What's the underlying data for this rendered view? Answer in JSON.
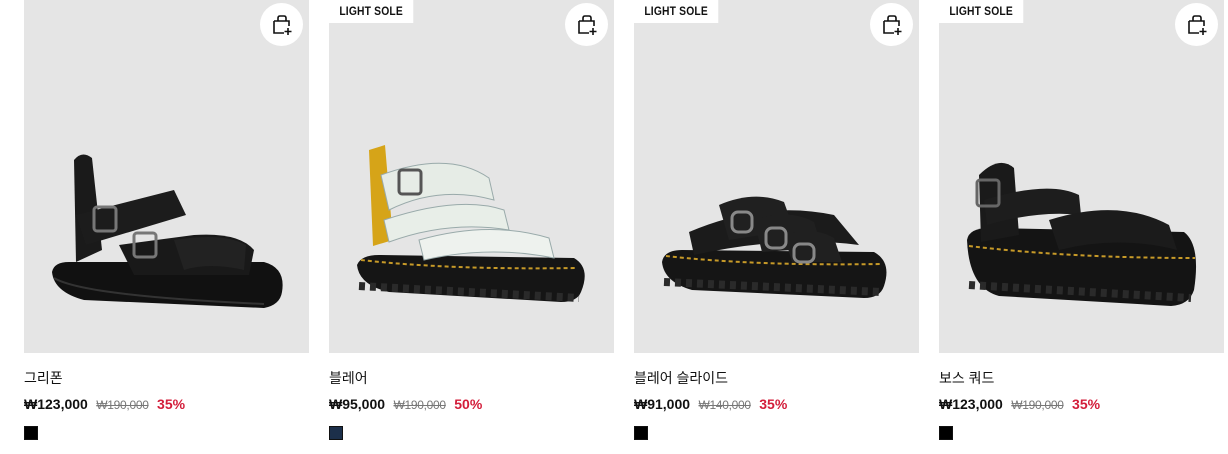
{
  "products": [
    {
      "name": "그리폰",
      "badge": "",
      "sale_price": "₩123,000",
      "original_price": "₩190,000",
      "discount": "35%",
      "swatches": [
        "#000000"
      ],
      "shoe_color": "black",
      "cart_icon": "add-to-cart-icon"
    },
    {
      "name": "블레어",
      "badge": "LIGHT SOLE",
      "sale_price": "₩95,000",
      "original_price": "₩190,000",
      "discount": "50%",
      "swatches": [
        "#1c2f4a"
      ],
      "shoe_color": "white",
      "cart_icon": "add-to-cart-icon"
    },
    {
      "name": "블레어 슬라이드",
      "badge": "LIGHT SOLE",
      "sale_price": "₩91,000",
      "original_price": "₩140,000",
      "discount": "35%",
      "swatches": [
        "#000000"
      ],
      "shoe_color": "black",
      "cart_icon": "add-to-cart-icon"
    },
    {
      "name": "보스 쿼드",
      "badge": "LIGHT SOLE",
      "sale_price": "₩123,000",
      "original_price": "₩190,000",
      "discount": "35%",
      "swatches": [
        "#000000"
      ],
      "shoe_color": "black",
      "cart_icon": "add-to-cart-icon"
    }
  ],
  "colors": {
    "discount": "#d31d3a",
    "image_bg": "#e5e5e5"
  }
}
